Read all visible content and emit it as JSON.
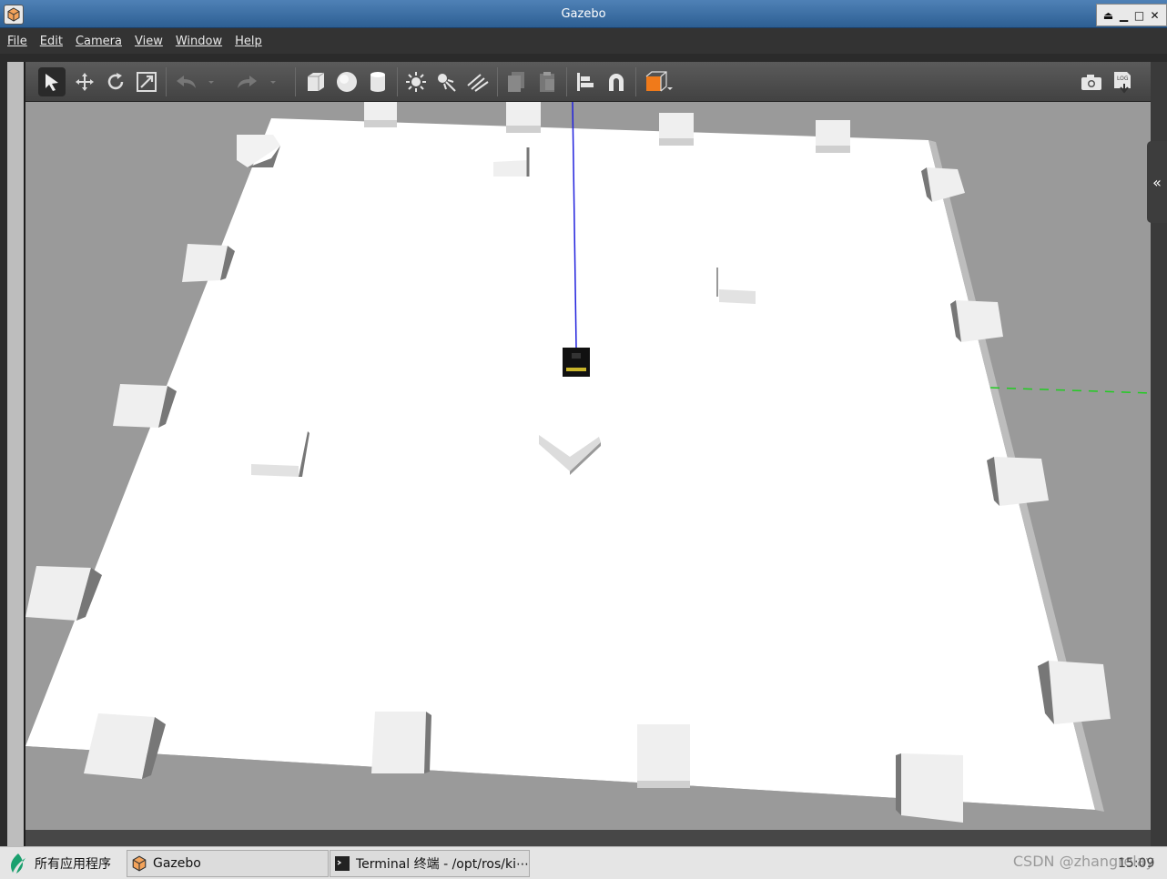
{
  "window": {
    "title": "Gazebo"
  },
  "menu": [
    "File",
    "Edit",
    "Camera",
    "View",
    "Window",
    "Help"
  ],
  "toolbar": {
    "tools": [
      "select-arrow-icon",
      "translate-icon",
      "rotate-icon",
      "scale-icon",
      "undo-icon",
      "redo-icon",
      "box-icon",
      "sphere-icon",
      "cylinder-icon",
      "point-light-icon",
      "spot-light-icon",
      "directional-light-icon",
      "copy-icon",
      "paste-icon",
      "align-icon",
      "snap-icon",
      "view-angle-icon",
      "screenshot-icon",
      "log-icon"
    ]
  },
  "side_panel": {
    "toggle_label": "«"
  },
  "taskbar": {
    "apps_label": "所有应用程序",
    "gazebo_label": "Gazebo",
    "terminal_label": "Terminal 终端 - /opt/ros/ki⋯",
    "watermark": "CSDN @zhangrelay",
    "clock": "15:09"
  },
  "colors": {
    "ground": "#ffffff",
    "viewport_bg": "#9a9a9a",
    "menubar": "#333333",
    "titlebar": "#2d5f93",
    "accent_orange": "#f07a1a"
  }
}
